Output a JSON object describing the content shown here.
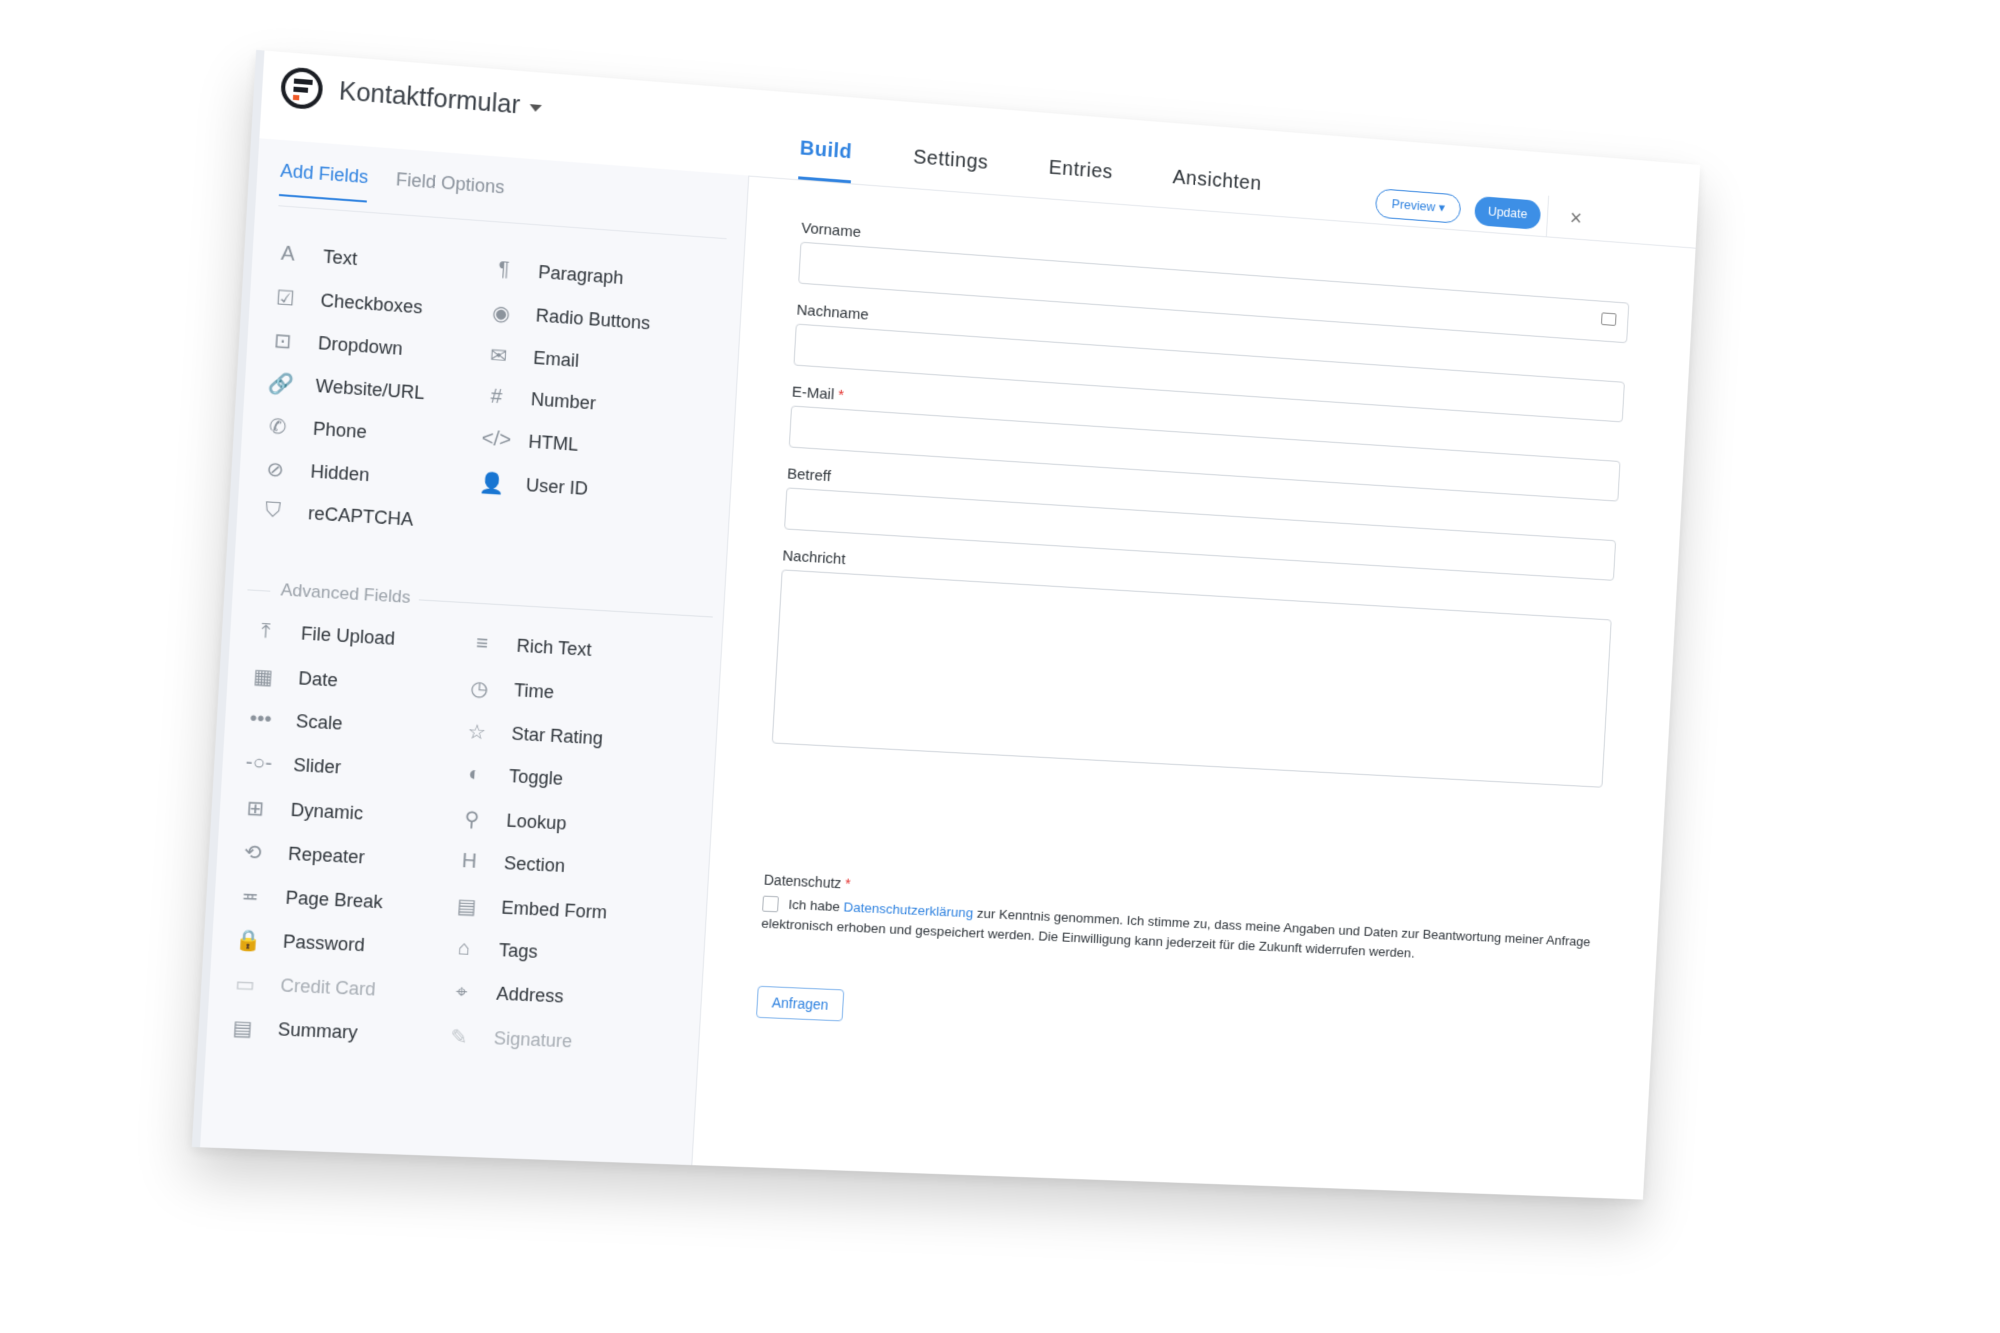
{
  "header": {
    "form_title": "Kontaktformular",
    "tabs": [
      "Build",
      "Settings",
      "Entries",
      "Ansichten"
    ],
    "preview_label": "Preview ▾",
    "update_label": "Update",
    "close_glyph": "×"
  },
  "sidebar": {
    "tabs": [
      "Add Fields",
      "Field Options"
    ],
    "fields_left": [
      {
        "label": "Text",
        "icon": "text-icon",
        "glyph": "A"
      },
      {
        "label": "Checkboxes",
        "icon": "checkbox-icon",
        "glyph": "☑"
      },
      {
        "label": "Dropdown",
        "icon": "dropdown-icon",
        "glyph": "⊡"
      },
      {
        "label": "Website/URL",
        "icon": "link-icon",
        "glyph": "🔗"
      },
      {
        "label": "Phone",
        "icon": "phone-icon",
        "glyph": "✆"
      },
      {
        "label": "Hidden",
        "icon": "eye-off-icon",
        "glyph": "⊘"
      },
      {
        "label": "reCAPTCHA",
        "icon": "shield-icon",
        "glyph": "⛉"
      }
    ],
    "fields_right": [
      {
        "label": "Paragraph",
        "icon": "paragraph-icon",
        "glyph": "¶"
      },
      {
        "label": "Radio Buttons",
        "icon": "radio-icon",
        "glyph": "◉"
      },
      {
        "label": "Email",
        "icon": "envelope-icon",
        "glyph": "✉"
      },
      {
        "label": "Number",
        "icon": "hash-icon",
        "glyph": "#"
      },
      {
        "label": "HTML",
        "icon": "code-icon",
        "glyph": "</>"
      },
      {
        "label": "User ID",
        "icon": "user-icon",
        "glyph": "👤"
      }
    ],
    "advanced_heading": "Advanced Fields",
    "advanced_left": [
      {
        "label": "File Upload",
        "icon": "upload-icon",
        "glyph": "⤒"
      },
      {
        "label": "Date",
        "icon": "calendar-icon",
        "glyph": "▦"
      },
      {
        "label": "Scale",
        "icon": "scale-icon",
        "glyph": "•••"
      },
      {
        "label": "Slider",
        "icon": "slider-icon",
        "glyph": "-○-"
      },
      {
        "label": "Dynamic",
        "icon": "sitemap-icon",
        "glyph": "⊞"
      },
      {
        "label": "Repeater",
        "icon": "repeat-icon",
        "glyph": "⟲"
      },
      {
        "label": "Page Break",
        "icon": "page-break-icon",
        "glyph": "≖"
      },
      {
        "label": "Password",
        "icon": "lock-icon",
        "glyph": "🔒"
      },
      {
        "label": "Credit Card",
        "icon": "credit-card-icon",
        "glyph": "▭",
        "disabled": true
      },
      {
        "label": "Summary",
        "icon": "document-icon",
        "glyph": "▤"
      }
    ],
    "advanced_right": [
      {
        "label": "Rich Text",
        "icon": "align-icon",
        "glyph": "≡"
      },
      {
        "label": "Time",
        "icon": "clock-icon",
        "glyph": "◷"
      },
      {
        "label": "Star Rating",
        "icon": "star-icon",
        "glyph": "☆"
      },
      {
        "label": "Toggle",
        "icon": "toggle-icon",
        "glyph": "◐"
      },
      {
        "label": "Lookup",
        "icon": "search-icon",
        "glyph": "⚲"
      },
      {
        "label": "Section",
        "icon": "heading-icon",
        "glyph": "H"
      },
      {
        "label": "Embed Form",
        "icon": "file-icon",
        "glyph": "▤"
      },
      {
        "label": "Tags",
        "icon": "tag-icon",
        "glyph": "⌂"
      },
      {
        "label": "Address",
        "icon": "map-pin-icon",
        "glyph": "⌖"
      },
      {
        "label": "Signature",
        "icon": "pen-icon",
        "glyph": "✎",
        "disabled": true
      }
    ]
  },
  "form": {
    "fields": [
      {
        "label": "Vorname",
        "required": false
      },
      {
        "label": "Nachname",
        "required": false
      },
      {
        "label": "E-Mail",
        "required": true
      },
      {
        "label": "Betreff",
        "required": false
      }
    ],
    "message_label": "Nachricht",
    "consent_label": "Datenschutz",
    "consent_prefix": "Ich habe",
    "consent_link": "Datenschutzerklärung",
    "consent_suffix": "zur Kenntnis genommen. Ich stimme zu, dass meine Angaben und Daten zur Beantwortung meiner Anfrage elektronisch erhoben und gespeichert werden. Die Einwilligung kann jederzeit für die Zukunft widerrufen werden.",
    "required_mark": "*",
    "submit_label": "Anfragen"
  },
  "colors": {
    "accent": "#3083e0",
    "required": "#e3312e",
    "brand_orange": "#f05a28"
  }
}
